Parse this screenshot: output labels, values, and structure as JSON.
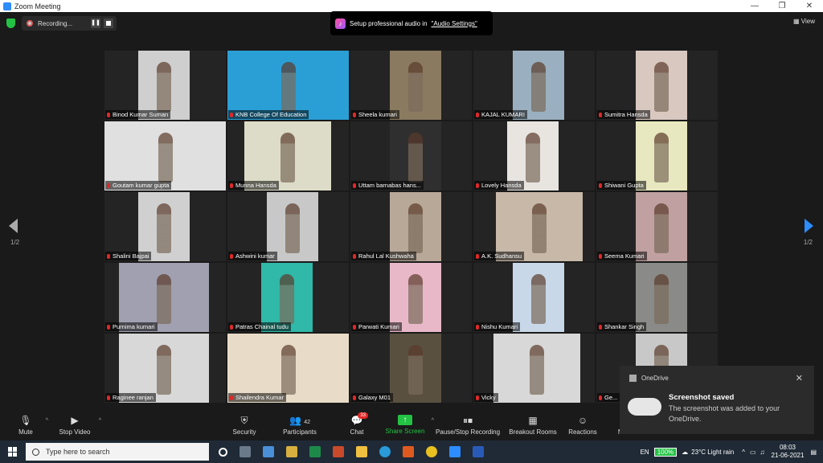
{
  "window": {
    "title": "Zoom Meeting",
    "controls": [
      "—",
      "❐",
      "✕"
    ]
  },
  "topbar": {
    "recording_label": "Recording...",
    "view_label": "View",
    "audio_tip": {
      "text": "Setup professional audio in",
      "link": "\"Audio Settings\""
    }
  },
  "pagination": {
    "left": "1/2",
    "right": "1/2"
  },
  "participants": [
    {
      "name": "Binod Kumar Suman",
      "bg": "#cfcfcf"
    },
    {
      "name": "KNB College Of Education",
      "bg": "#2a9fd6",
      "active": true
    },
    {
      "name": "Sheela kumari",
      "bg": "#8a7a60"
    },
    {
      "name": "KAJAL KUMARI",
      "bg": "#9ab0c0"
    },
    {
      "name": "Sumitra Hansda",
      "bg": "#d8c8c0"
    },
    {
      "name": "Goutam kumar gupta",
      "bg": "#e0e0e0"
    },
    {
      "name": "Munna Hansda",
      "bg": "#dcdcc8"
    },
    {
      "name": "Uttam barnabas hans...",
      "bg": "#2f2f2f"
    },
    {
      "name": "Lovely Hansda",
      "bg": "#e8e4e0"
    },
    {
      "name": "Shiwani Gupta",
      "bg": "#e8e8c0"
    },
    {
      "name": "Shalini Bajpai",
      "bg": "#d0d0d0"
    },
    {
      "name": "Ashwini kumar",
      "bg": "#c8c8c8"
    },
    {
      "name": "Rahul Lal Kushwaha",
      "bg": "#b8a898"
    },
    {
      "name": "A.K. Sudhansu",
      "bg": "#c8b8a8"
    },
    {
      "name": "Seema Kumari",
      "bg": "#c0a0a0"
    },
    {
      "name": "Purnima kumari",
      "bg": "#a0a0b0"
    },
    {
      "name": "Patras Chainal tudu",
      "bg": "#30b8a8"
    },
    {
      "name": "Parwati Kumari",
      "bg": "#e8b8c8"
    },
    {
      "name": "Nishu Kumari",
      "bg": "#c8d8e8"
    },
    {
      "name": "Shankar Singh",
      "bg": "#8a8a88"
    },
    {
      "name": "Raginee ranjan",
      "bg": "#d8d8d8"
    },
    {
      "name": "Shailendra Kumar",
      "bg": "#e8dcc8"
    },
    {
      "name": "Galaxy M01",
      "bg": "#5a5040"
    },
    {
      "name": "Vicky",
      "bg": "#d8d8d8"
    },
    {
      "name": "Ge...",
      "bg": "#c8c8c8"
    }
  ],
  "toolbar": {
    "mute": "Mute",
    "stop_video": "Stop Video",
    "security": "Security",
    "participants": "Participants",
    "participants_count": "42",
    "chat": "Chat",
    "chat_badge": "33",
    "share_screen": "Share Screen",
    "pause_recording": "Pause/Stop Recording",
    "breakout": "Breakout Rooms",
    "reactions": "Reactions",
    "more": "More"
  },
  "toast": {
    "app": "OneDrive",
    "title": "Screenshot saved",
    "body": "The screenshot was added to your OneDrive."
  },
  "taskbar": {
    "search_placeholder": "Type here to search",
    "lang": "EN",
    "battery": "100%",
    "weather": "23°C  Light rain",
    "time": "08:03",
    "date": "21-06-2021"
  },
  "colors": {
    "accent": "#2d8cff",
    "active_speaker": "#e5e04a",
    "share_green": "#23c244",
    "muted_red": "#e02828"
  }
}
